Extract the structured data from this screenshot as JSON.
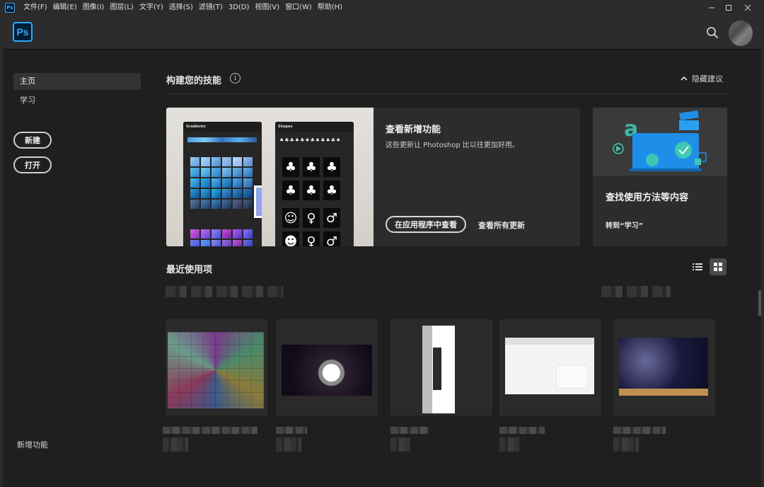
{
  "menubar": {
    "items": [
      "文件(F)",
      "编辑(E)",
      "图像(I)",
      "图层(L)",
      "文字(Y)",
      "选择(S)",
      "滤镜(T)",
      "3D(D)",
      "视图(V)",
      "窗口(W)",
      "帮助(H)"
    ],
    "app_icon_text": "Ps"
  },
  "appbar": {
    "logo_text": "Ps"
  },
  "sidebar": {
    "home": "主页",
    "learn": "学习",
    "new_button": "新建",
    "open_button": "打开",
    "whats_new": "新增功能"
  },
  "skills": {
    "title": "构建您的技能",
    "info": "i",
    "hide_label": "隐藏建议"
  },
  "feature_card": {
    "panel_gradients": "Gradients",
    "panel_shapes": "Shapes",
    "title": "查看新增功能",
    "description": "这些更新让 Photoshop 比以往更加好用。",
    "view_in_app_button": "在应用程序中查看",
    "view_all_link": "查看所有更新"
  },
  "learn_card": {
    "title": "查找使用方法等内容",
    "link": "转到“学习”"
  },
  "recent": {
    "title": "最近使用项",
    "view_mode": "grid"
  },
  "colors": {
    "accent": "#31a8ff",
    "background": "#1f1f1f",
    "card": "#2c2c2c"
  }
}
